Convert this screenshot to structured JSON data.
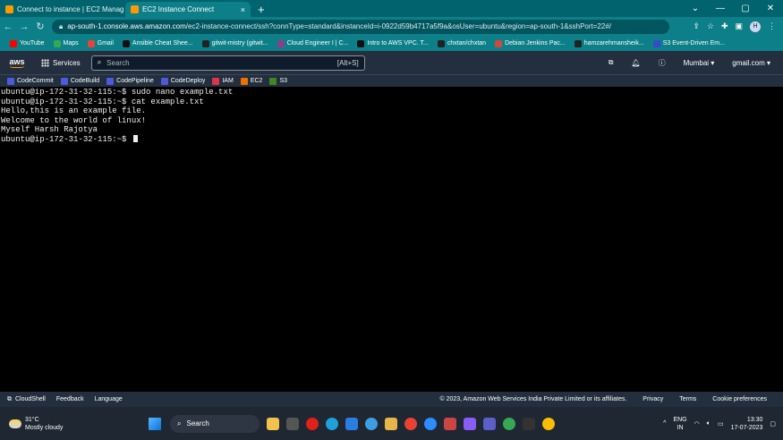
{
  "browser": {
    "tabs": [
      {
        "label": "Connect to instance | EC2 Manag",
        "color": "#ff9900"
      },
      {
        "label": "EC2 Instance Connect",
        "color": "#ff9900"
      }
    ],
    "url_domain": "ap-south-1.console.aws.amazon.com",
    "url_path": "/ec2-instance-connect/ssh?connType=standard&instanceId=i-0922d59b4717a5f9a&osUser=ubuntu&region=ap-south-1&sshPort=22#/",
    "avatar": "H",
    "bookmarks": [
      {
        "label": "YouTube",
        "color": "#ff0000"
      },
      {
        "label": "Maps",
        "color": "#34a853"
      },
      {
        "label": "Gmail",
        "color": "#ea4335"
      },
      {
        "label": "Ansible Cheat Shee...",
        "color": "#111111"
      },
      {
        "label": "gitwit-mistry (gitwit...",
        "color": "#222222"
      },
      {
        "label": "Cloud Engineer I | C...",
        "color": "#8e3c8e"
      },
      {
        "label": "Intro to AWS VPC. T...",
        "color": "#111111"
      },
      {
        "label": "chxtan/chxtan",
        "color": "#222222"
      },
      {
        "label": "Debian Jenkins Pac...",
        "color": "#d24939"
      },
      {
        "label": "hamzarehmansheik...",
        "color": "#222222"
      },
      {
        "label": "S3 Event-Driven Em...",
        "color": "#3b48cc"
      }
    ]
  },
  "aws": {
    "logo": "aws",
    "services_label": "Services",
    "search_placeholder": "Search",
    "search_shortcut": "[Alt+S]",
    "region": "Mumbai ▾",
    "account": "gmail.com ▾",
    "favorites": [
      {
        "label": "CodeCommit",
        "color": "#4d5bd9"
      },
      {
        "label": "CodeBuild",
        "color": "#4d5bd9"
      },
      {
        "label": "CodePipeline",
        "color": "#4d5bd9"
      },
      {
        "label": "CodeDeploy",
        "color": "#4d5bd9"
      },
      {
        "label": "IAM",
        "color": "#dd344c"
      },
      {
        "label": "EC2",
        "color": "#ed7100"
      },
      {
        "label": "S3",
        "color": "#3f8624"
      }
    ]
  },
  "terminal": {
    "lines": [
      "ubuntu@ip-172-31-32-115:~$ sudo nano example.txt",
      "ubuntu@ip-172-31-32-115:~$ cat example.txt",
      "Hello,this is an example file.",
      "Welcome to the world of linux!",
      "Myself Harsh Rajotya",
      "ubuntu@ip-172-31-32-115:~$ "
    ]
  },
  "footer": {
    "cloudshell": "CloudShell",
    "feedback": "Feedback",
    "language": "Language",
    "copyright": "© 2023, Amazon Web Services India Private Limited or its affiliates.",
    "privacy": "Privacy",
    "terms": "Terms",
    "cookies": "Cookie preferences"
  },
  "taskbar": {
    "temp": "31°C",
    "weather": "Mostly cloudy",
    "search": "Search",
    "lang1": "ENG",
    "lang2": "IN",
    "time": "13:30",
    "date": "17-07-2023"
  }
}
